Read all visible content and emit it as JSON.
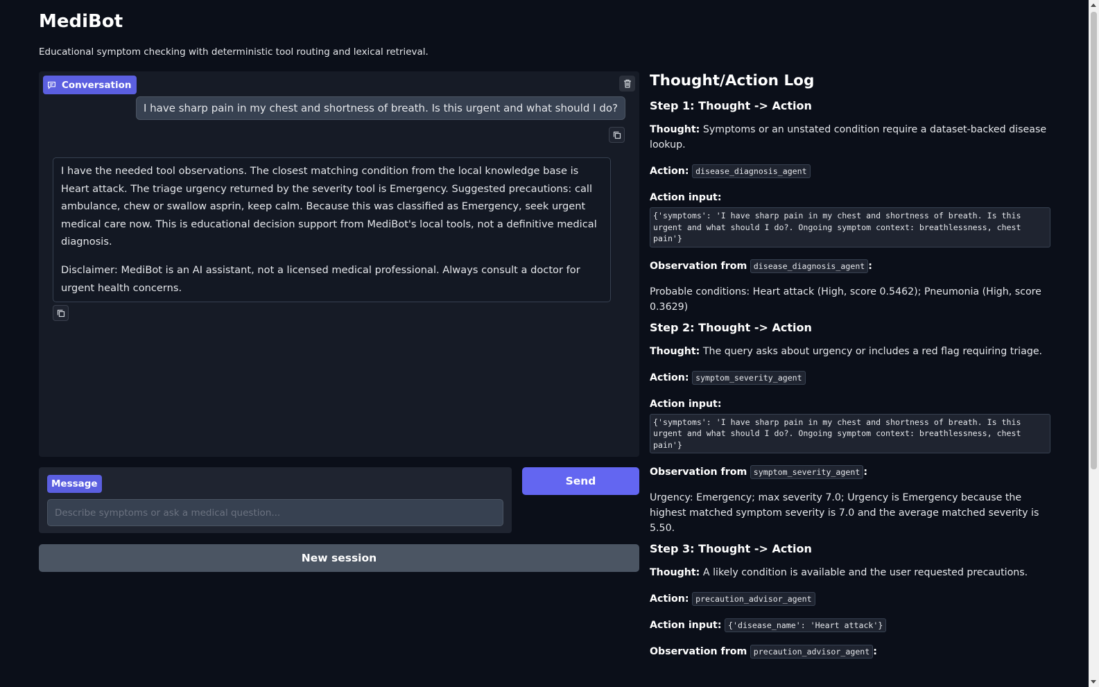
{
  "app": {
    "title": "MediBot",
    "subtitle": "Educational symptom checking with deterministic tool routing and lexical retrieval."
  },
  "chat": {
    "label": "Conversation",
    "clear_icon": "trash-icon",
    "copy_icon": "copy-icon",
    "user_message": "I have sharp pain in my chest and shortness of breath. Is this urgent and what should I do?",
    "bot_paragraph_1": "I have the needed tool observations. The closest matching condition from the local knowledge base is Heart attack. The triage urgency returned by the severity tool is Emergency. Suggested precautions: call ambulance, chew or swallow asprin, keep calm. Because this was classified as Emergency, seek urgent medical care now. This is educational decision support from MediBot's local tools, not a definitive medical diagnosis.",
    "bot_paragraph_2": "Disclaimer: MediBot is an AI assistant, not a licensed medical professional. Always consult a doctor for urgent health concerns."
  },
  "composer": {
    "label": "Message",
    "placeholder": "Describe symptoms or ask a medical question...",
    "value": "",
    "send_label": "Send",
    "new_session_label": "New session"
  },
  "log": {
    "title": "Thought/Action Log",
    "thought_label": "Thought:",
    "action_label": "Action:",
    "action_input_label": "Action input:",
    "observation_label": "Observation from",
    "steps": [
      {
        "heading": "Step 1: Thought -> Action",
        "thought": "Symptoms or an unstated condition require a dataset-backed disease lookup.",
        "action": "disease_diagnosis_agent",
        "action_input": "{'symptoms': 'I have sharp pain in my chest and shortness of breath. Is this urgent and what should I do?. Ongoing symptom context: breathlessness, chest pain'}",
        "observation": "Probable conditions: Heart attack (High, score 0.5462); Pneumonia (High, score 0.3629)"
      },
      {
        "heading": "Step 2: Thought -> Action",
        "thought": "The query asks about urgency or includes a red flag requiring triage.",
        "action": "symptom_severity_agent",
        "action_input": "{'symptoms': 'I have sharp pain in my chest and shortness of breath. Is this urgent and what should I do?. Ongoing symptom context: breathlessness, chest pain'}",
        "observation": "Urgency: Emergency; max severity 7.0; Urgency is Emergency because the highest matched symptom severity is 7.0 and the average matched severity is 5.50."
      },
      {
        "heading": "Step 3: Thought -> Action",
        "thought": "A likely condition is available and the user requested precautions.",
        "action": "precaution_advisor_agent",
        "action_input": "{'disease_name': 'Heart attack'}",
        "observation": ""
      }
    ]
  },
  "colors": {
    "background": "#0b0f19",
    "panel": "#161b26",
    "accent": "#6366f1",
    "badge": "#5b5fe0",
    "secondary_button": "#4b5563"
  }
}
